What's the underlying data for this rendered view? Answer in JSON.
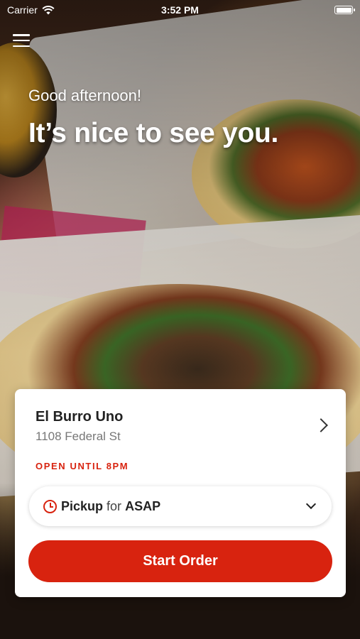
{
  "status_bar": {
    "carrier": "Carrier",
    "time": "3:52 PM",
    "battery_level": 1.0
  },
  "header": {
    "menu_icon": "hamburger-menu-icon"
  },
  "greeting": {
    "subtitle": "Good afternoon!",
    "headline": "It’s nice to see you."
  },
  "location_card": {
    "store_name": "El Burro Uno",
    "address": "1108 Federal St",
    "hours_status": "OPEN UNTIL 8PM",
    "order_type": "Pickup",
    "for_label": "for",
    "order_time": "ASAP",
    "start_order_label": "Start Order"
  },
  "colors": {
    "accent": "#d8230f",
    "card_background": "#ffffff",
    "text_primary": "#222222",
    "text_secondary": "#777777"
  }
}
